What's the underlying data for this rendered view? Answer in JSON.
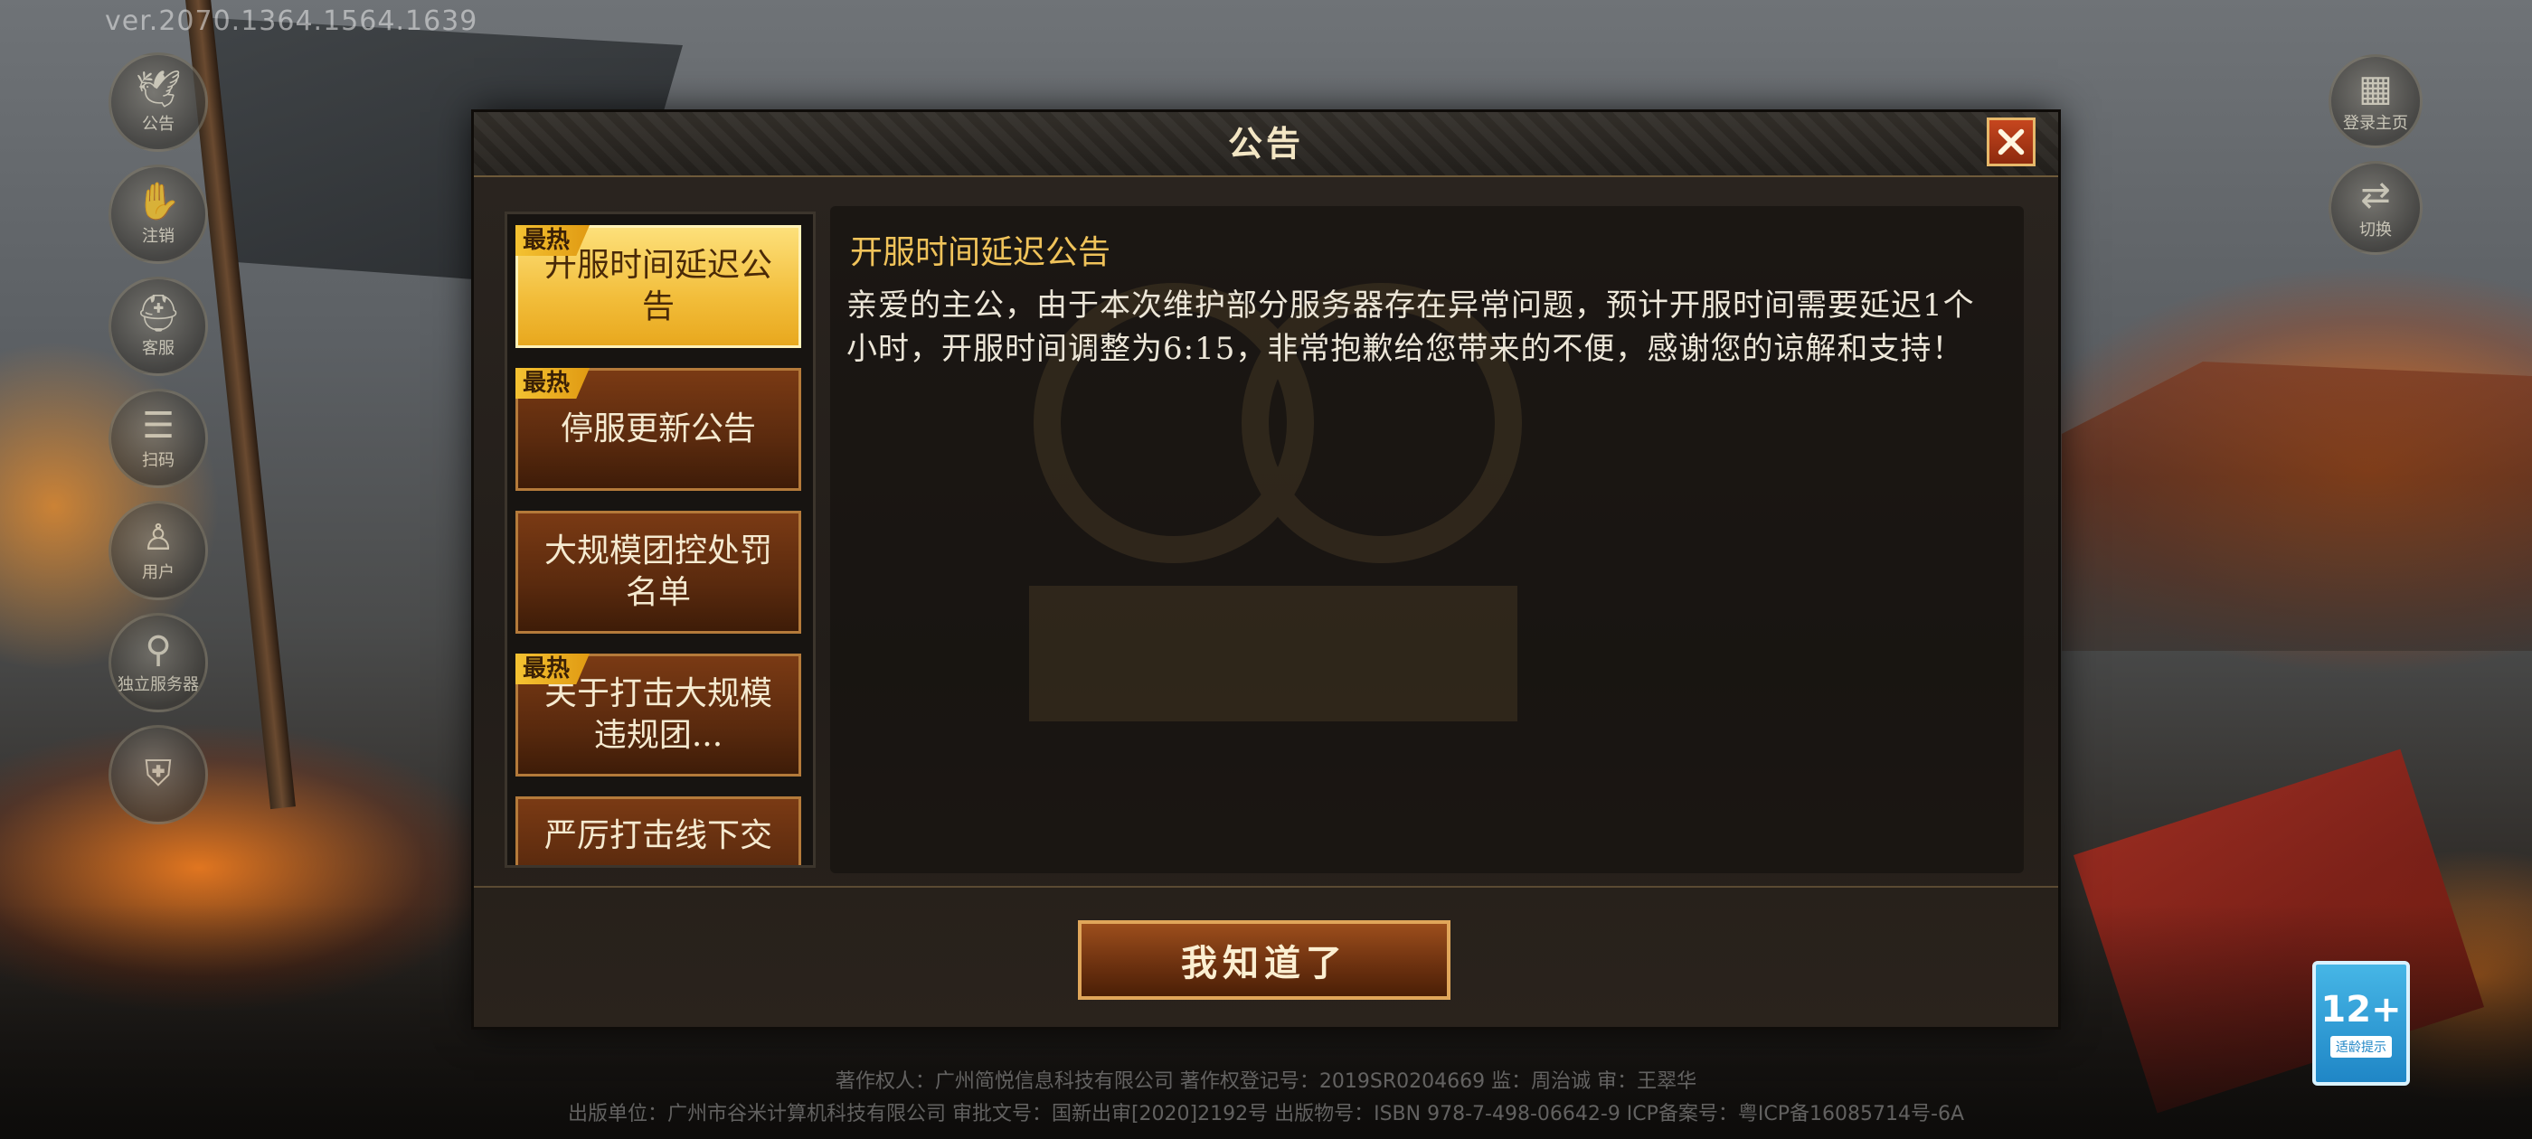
{
  "version_text": "ver.2070.1364.1564.1639",
  "left_menu": [
    {
      "icon": "bird-icon",
      "glyph": "🕊",
      "label": "公告"
    },
    {
      "icon": "hand-icon",
      "glyph": "✋",
      "label": "注销"
    },
    {
      "icon": "helmet-icon",
      "glyph": "⛑",
      "label": "客服"
    },
    {
      "icon": "list-icon",
      "glyph": "☰",
      "label": "扫码"
    },
    {
      "icon": "person-icon",
      "glyph": "♙",
      "label": "用户"
    },
    {
      "icon": "map-pin-icon",
      "glyph": "⚲",
      "label": "独立服务器"
    },
    {
      "icon": "shield-icon",
      "glyph": "⛨",
      "label": ""
    }
  ],
  "right_menu": [
    {
      "icon": "grid-icon",
      "glyph": "▦",
      "label": "登录主页"
    },
    {
      "icon": "switch-icon",
      "glyph": "⇄",
      "label": "切换"
    }
  ],
  "modal": {
    "title": "公告",
    "list": [
      {
        "label": "开服时间延迟公告",
        "hot": true,
        "selected": true
      },
      {
        "label": "停服更新公告",
        "hot": true,
        "selected": false
      },
      {
        "label": "大规模团控处罚名单",
        "hot": false,
        "selected": false
      },
      {
        "label": "关于打击大规模违规团...",
        "hot": true,
        "selected": false
      },
      {
        "label": "严厉打击线下交",
        "hot": false,
        "selected": false
      }
    ],
    "hot_label": "最热",
    "content_title": "开服时间延迟公告",
    "content_body": "亲爱的主公，由于本次维护部分服务器存在异常问题，预计开服时间需要延迟1个小时，开服时间调整为6:15，非常抱歉给您带来的不便，感谢您的谅解和支持！",
    "confirm_label": "我知道了"
  },
  "rating_badge": {
    "age": "12+",
    "sub": "适龄提示"
  },
  "footer": {
    "line1": "著作权人：广州简悦信息科技有限公司    著作权登记号：2019SR0204669    监：周治诚  审：王翠华 ",
    "line2": "出版单位：广州市谷米计算机科技有限公司 审批文号：国新出审[2020]2192号 出版物号：ISBN 978-7-498-06642-9 ICP备案号：粤ICP备16085714号-6A"
  }
}
